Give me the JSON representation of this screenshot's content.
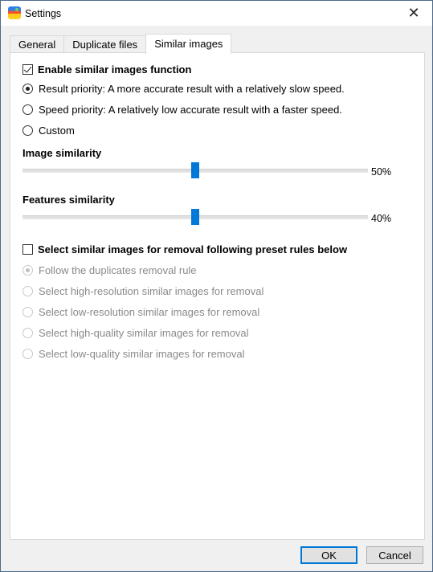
{
  "window": {
    "title": "Settings",
    "app_icon": "photo-app-icon",
    "close_icon": "close-icon"
  },
  "tabs": [
    {
      "label": "General",
      "active": false
    },
    {
      "label": "Duplicate files",
      "active": false
    },
    {
      "label": "Similar images",
      "active": true
    }
  ],
  "similar_images": {
    "enable_checkbox": {
      "label": "Enable similar images function",
      "checked": true
    },
    "mode_options": [
      {
        "label": "Result priority: A more accurate result with a relatively slow speed.",
        "selected": true
      },
      {
        "label": "Speed priority: A relatively low accurate result with a faster speed.",
        "selected": false
      },
      {
        "label": "Custom",
        "selected": false
      }
    ],
    "image_similarity": {
      "title": "Image similarity",
      "value_percent": 50,
      "value_label": "50%"
    },
    "features_similarity": {
      "title": "Features similarity",
      "value_percent": 50,
      "value_label": "40%"
    },
    "removal_checkbox": {
      "label": "Select similar images for removal following preset rules below",
      "checked": false
    },
    "removal_rules": [
      {
        "label": "Follow the duplicates removal rule",
        "selected": true,
        "enabled": false
      },
      {
        "label": "Select high-resolution similar images for removal",
        "selected": false,
        "enabled": false
      },
      {
        "label": "Select low-resolution similar images for removal",
        "selected": false,
        "enabled": false
      },
      {
        "label": "Select high-quality similar images for removal",
        "selected": false,
        "enabled": false
      },
      {
        "label": "Select low-quality similar images for removal",
        "selected": false,
        "enabled": false
      }
    ]
  },
  "buttons": {
    "ok": "OK",
    "cancel": "Cancel"
  },
  "colors": {
    "accent": "#0078d7"
  }
}
